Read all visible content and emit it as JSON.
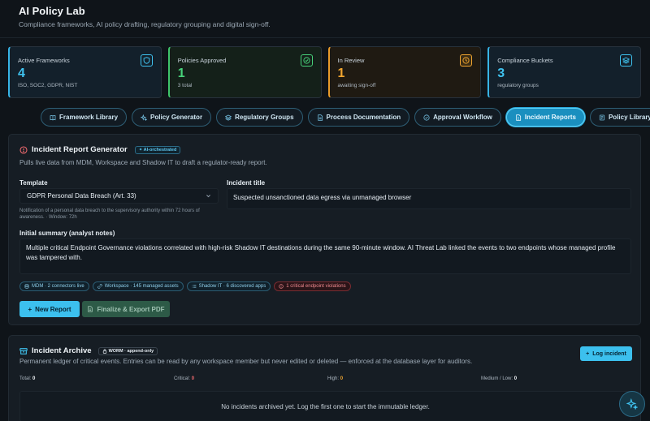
{
  "header": {
    "title": "AI Policy Lab",
    "subtitle": "Compliance frameworks, AI policy drafting, regulatory grouping and digital sign-off."
  },
  "stats_cards": [
    {
      "label": "Active Frameworks",
      "value": "4",
      "sub": "ISO, SOC2, GDPR, NIST",
      "icon": "shield-icon",
      "color": "#3fc3f0"
    },
    {
      "label": "Policies Approved",
      "value": "1",
      "sub": "3 total",
      "icon": "check-circle-icon",
      "color": "#47d27a"
    },
    {
      "label": "In Review",
      "value": "1",
      "sub": "awaiting sign-off",
      "icon": "clock-icon",
      "color": "#f0a530"
    },
    {
      "label": "Compliance Buckets",
      "value": "3",
      "sub": "regulatory groups",
      "icon": "layers-icon",
      "color": "#3fc3f0"
    }
  ],
  "tabs": [
    {
      "label": "Framework Library",
      "icon": "book-icon"
    },
    {
      "label": "Policy Generator",
      "icon": "sparkles-icon"
    },
    {
      "label": "Regulatory Groups",
      "icon": "layers-icon"
    },
    {
      "label": "Process Documentation",
      "icon": "document-icon"
    },
    {
      "label": "Approval Workflow",
      "icon": "check-circle-icon"
    },
    {
      "label": "Incident Reports",
      "icon": "file-alert-icon",
      "active": true
    },
    {
      "label": "Policy Library",
      "icon": "library-icon"
    }
  ],
  "generator": {
    "title": "Incident Report Generator",
    "badge": "AI-orchestrated",
    "description": "Pulls live data from MDM, Workspace and Shadow IT to draft a regulator-ready report.",
    "template_label": "Template",
    "template_value": "GDPR Personal Data Breach (Art. 33)",
    "template_hint": "Notification of a personal data breach to the supervisory authority within 72 hours of awareness. · Window: 72h",
    "incident_title_label": "Incident title",
    "incident_title_value": "Suspected unsanctioned data egress via unmanaged browser",
    "summary_label": "Initial summary (analyst notes)",
    "summary_value": "Multiple critical Endpoint Governance violations correlated with high-risk Shadow IT destinations during the same 90-minute window. AI Threat Lab linked the events to two endpoints whose managed profile was tampered with.",
    "chips": [
      {
        "label": "MDM · 2 connectors live",
        "icon": "database-icon"
      },
      {
        "label": "Workspace · 145 managed assets",
        "icon": "link-icon"
      },
      {
        "label": "Shadow IT · 6 discovered apps",
        "icon": "list-icon"
      },
      {
        "label": "1 critical endpoint violations",
        "icon": "alert-circle-icon",
        "danger": true
      }
    ],
    "new_report_label": "New Report",
    "export_label": "Finalize & Export PDF"
  },
  "archive": {
    "title": "Incident Archive",
    "worm_badge": "WORM · append-only",
    "description": "Permanent ledger of critical events. Entries can be read by any workspace member but never edited or deleted — enforced at the database layer for auditors.",
    "log_button": "Log incident",
    "stats": {
      "total_label": "Total:",
      "total_value": "0",
      "critical_label": "Critical:",
      "critical_value": "0",
      "high_label": "High:",
      "high_value": "0",
      "medlow_label": "Medium / Low:",
      "medlow_value": "0"
    },
    "empty_text": "No incidents archived yet. Log the first one to start the immutable ledger."
  }
}
